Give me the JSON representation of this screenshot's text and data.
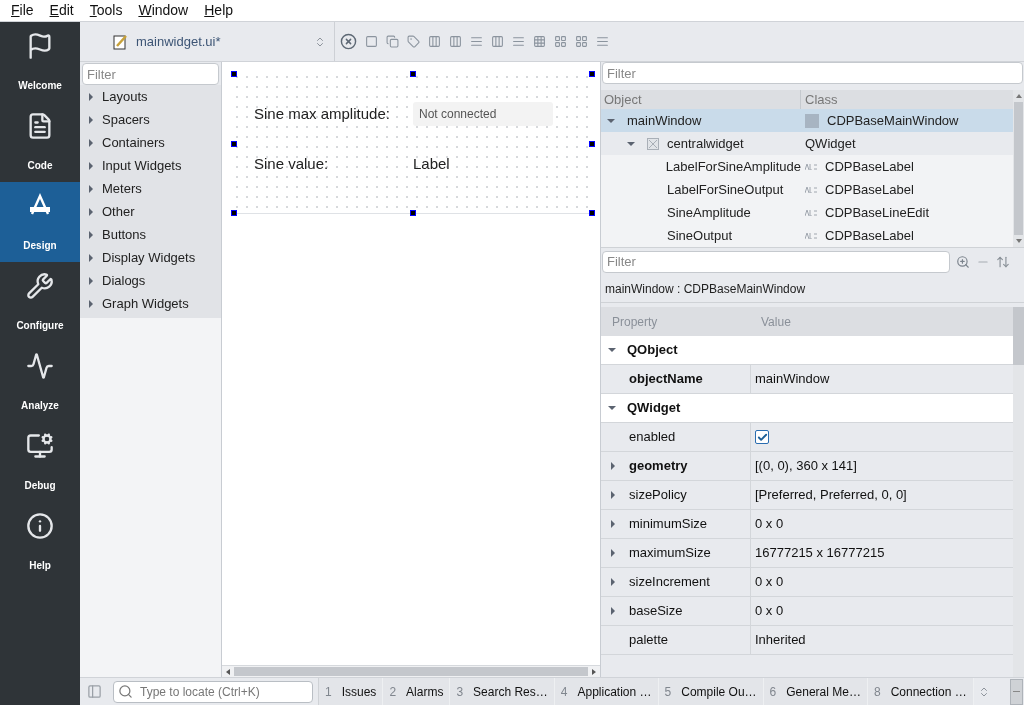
{
  "menu": [
    "File",
    "Edit",
    "Tools",
    "Window",
    "Help"
  ],
  "modes": [
    {
      "label": "Welcome",
      "selected": false
    },
    {
      "label": "Code",
      "selected": false
    },
    {
      "label": "Design",
      "selected": true
    },
    {
      "label": "Configure",
      "selected": false
    },
    {
      "label": "Analyze",
      "selected": false
    },
    {
      "label": "Debug",
      "selected": false
    },
    {
      "label": "Help",
      "selected": false
    }
  ],
  "document": {
    "name": "mainwidget.ui*"
  },
  "widget_box": {
    "filter": {
      "placeholder": "Filter"
    },
    "categories": [
      {
        "label": "Layouts",
        "expanded": false
      },
      {
        "label": "Spacers",
        "expanded": false
      },
      {
        "label": "Containers",
        "expanded": false
      },
      {
        "label": "Input Widgets",
        "expanded": false
      },
      {
        "label": "Meters",
        "expanded": false
      },
      {
        "label": "Other",
        "expanded": false
      },
      {
        "label": "Buttons",
        "expanded": false
      },
      {
        "label": "Display Widgets",
        "expanded": false
      },
      {
        "label": "Dialogs",
        "expanded": false
      },
      {
        "label": "Graph Widgets",
        "expanded": false
      }
    ]
  },
  "form": {
    "rows": [
      {
        "label": "Sine max amplitude:",
        "kind": "field",
        "value": "Not connected"
      },
      {
        "label": "Sine value:",
        "kind": "label",
        "value": "Label"
      }
    ]
  },
  "object_inspector": {
    "filter": {
      "placeholder": "Filter"
    },
    "columns": [
      "Object",
      "Class"
    ],
    "tree": [
      {
        "object": "mainWindow",
        "class": "CDPBaseMainWindow",
        "kind": "window",
        "selected": true,
        "expanded": true,
        "children": [
          {
            "object": "centralwidget",
            "class": "QWidget",
            "kind": "widget",
            "selected": false,
            "expanded": true,
            "children": [
              {
                "object": "LabelForSineAmplitude",
                "class": "CDPBaseLabel",
                "kind": "text",
                "selected": false
              },
              {
                "object": "LabelForSineOutput",
                "class": "CDPBaseLabel",
                "kind": "text",
                "selected": false
              },
              {
                "object": "SineAmplitude",
                "class": "CDPBaseLineEdit",
                "kind": "text",
                "selected": false
              },
              {
                "object": "SineOutput",
                "class": "CDPBaseLabel",
                "kind": "text",
                "selected": false
              }
            ]
          }
        ]
      }
    ]
  },
  "property_editor": {
    "filter": {
      "placeholder": "Filter"
    },
    "subject": "mainWindow : CDPBaseMainWindow",
    "columns": [
      "Property",
      "Value"
    ],
    "rows": [
      {
        "kind": "group",
        "name": "QObject",
        "expanded": true
      },
      {
        "kind": "text",
        "name": "objectName",
        "value": "mainWindow",
        "changed": true
      },
      {
        "kind": "group",
        "name": "QWidget",
        "expanded": true
      },
      {
        "kind": "checkbox",
        "name": "enabled",
        "checked": true,
        "changed": false
      },
      {
        "kind": "text",
        "name": "geometry",
        "value": "[(0, 0), 360 x 141]",
        "changed": true,
        "expanded": false
      },
      {
        "kind": "text",
        "name": "sizePolicy",
        "value": "[Preferred, Preferred, 0, 0]",
        "changed": false,
        "expanded": false
      },
      {
        "kind": "text",
        "name": "minimumSize",
        "value": "0 x 0",
        "changed": false,
        "expanded": false
      },
      {
        "kind": "text",
        "name": "maximumSize",
        "value": "16777215 x 16777215",
        "changed": false,
        "expanded": false
      },
      {
        "kind": "text",
        "name": "sizeIncrement",
        "value": "0 x 0",
        "changed": false,
        "expanded": false
      },
      {
        "kind": "text",
        "name": "baseSize",
        "value": "0 x 0",
        "changed": false,
        "expanded": false
      },
      {
        "kind": "text",
        "name": "palette",
        "value": "Inherited",
        "changed": false
      }
    ]
  },
  "locator": {
    "placeholder": "Type to locate (Ctrl+K)"
  },
  "output_tabs": [
    {
      "number": "1",
      "label": "Issues"
    },
    {
      "number": "2",
      "label": "Alarms"
    },
    {
      "number": "3",
      "label": "Search Res…"
    },
    {
      "number": "4",
      "label": "Application …"
    },
    {
      "number": "5",
      "label": "Compile Ou…"
    },
    {
      "number": "6",
      "label": "General Me…"
    },
    {
      "number": "8",
      "label": "Connection …"
    }
  ]
}
